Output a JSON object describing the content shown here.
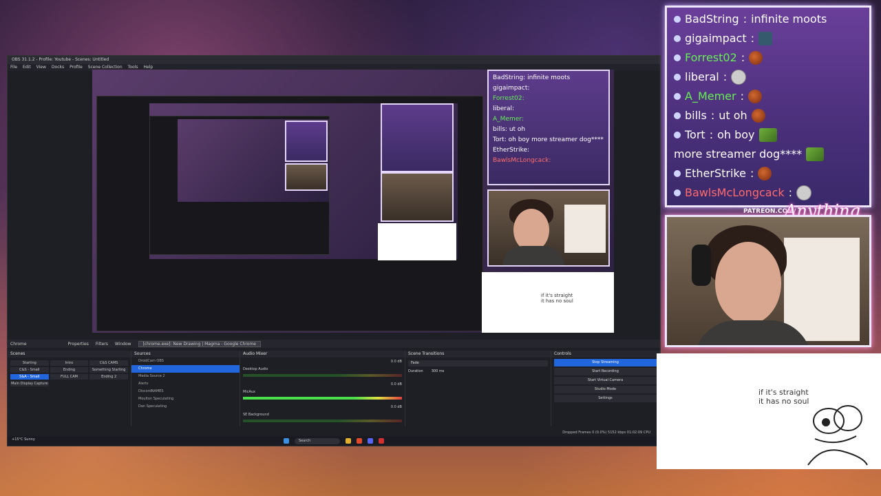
{
  "window": {
    "title": "OBS 31.1.2 - Profile: Youtube - Scenes: Untitled"
  },
  "menu": [
    "File",
    "Edit",
    "View",
    "Docks",
    "Profile",
    "Scene Collection",
    "Tools",
    "Help"
  ],
  "chat_overlay": {
    "messages": [
      {
        "user": "BadString",
        "text": "infinite moots",
        "user_color": "#ffffff",
        "emote": ""
      },
      {
        "user": "gigaimpact",
        "text": "",
        "user_color": "#ffffff",
        "emote": "face-tag"
      },
      {
        "user": "Forrest02",
        "text": "",
        "user_color": "#66ef55",
        "emote": "cookie"
      },
      {
        "user": "liberal",
        "text": "",
        "user_color": "#ffffff",
        "emote": "trollface"
      },
      {
        "user": "A_Memer",
        "text": "",
        "user_color": "#66ef55",
        "emote": "cookie"
      },
      {
        "user": "bills",
        "text": "ut oh",
        "user_color": "#ffffff",
        "emote": "cookie"
      },
      {
        "user": "Tort",
        "text": "oh boy",
        "text2": "more streamer dog****",
        "user_color": "#ffffff",
        "emote": "pepe"
      },
      {
        "user": "EtherStrike",
        "text": "",
        "user_color": "#ffffff",
        "emote": "cookie"
      },
      {
        "user": "BawlsMcLongcack",
        "text": "",
        "user_color": "#ff6b6b",
        "emote": "trollface"
      }
    ],
    "patreon": "PATREON.COM/",
    "signature": "Anything Else"
  },
  "whiteboard": {
    "line1": "if it's straight",
    "line2": "it has no soul"
  },
  "dock": {
    "current_source": "Chrome",
    "properties": "Properties",
    "filters": "Filters",
    "window_label": "Window",
    "window_value": "[chrome.exe]: New Drawing | Magma - Google Chrome"
  },
  "scenes": {
    "title": "Scenes",
    "items": [
      "Starting",
      "Intro",
      "C&S CAMS",
      "C&S - Small",
      "Ending",
      "Something Starting",
      "S&A - Small",
      "FULL CAM",
      "Ending 2",
      "Main Display Capture"
    ],
    "active_index": 6
  },
  "sources": {
    "title": "Sources",
    "items": [
      "DroidCam OBS",
      "Chrome",
      "Media Source 2",
      "Alerts",
      "DiscordNAMES",
      "Moulton Speculating",
      "Dan Speculating"
    ],
    "active_index": 1
  },
  "mixer": {
    "title": "Audio Mixer",
    "channels": [
      {
        "name": "Desktop Audio",
        "level": "0.0 dB"
      },
      {
        "name": "MicAux",
        "level": "0.0 dB"
      },
      {
        "name": "SE Background",
        "level": "0.0 dB"
      }
    ]
  },
  "transitions": {
    "title": "Scene Transitions",
    "type": "Fade",
    "duration_label": "Duration",
    "duration": "300 ms"
  },
  "controls": {
    "title": "Controls",
    "buttons": [
      "Stop Streaming",
      "Start Recording",
      "Start Virtual Camera",
      "Studio Mode",
      "Settings"
    ]
  },
  "status": {
    "text": "Dropped Frames 0 (0.0%)   5152 kbps   01:02:09   CPU"
  },
  "taskbar": {
    "search": "Search",
    "weather": "+15°C Sunny"
  }
}
